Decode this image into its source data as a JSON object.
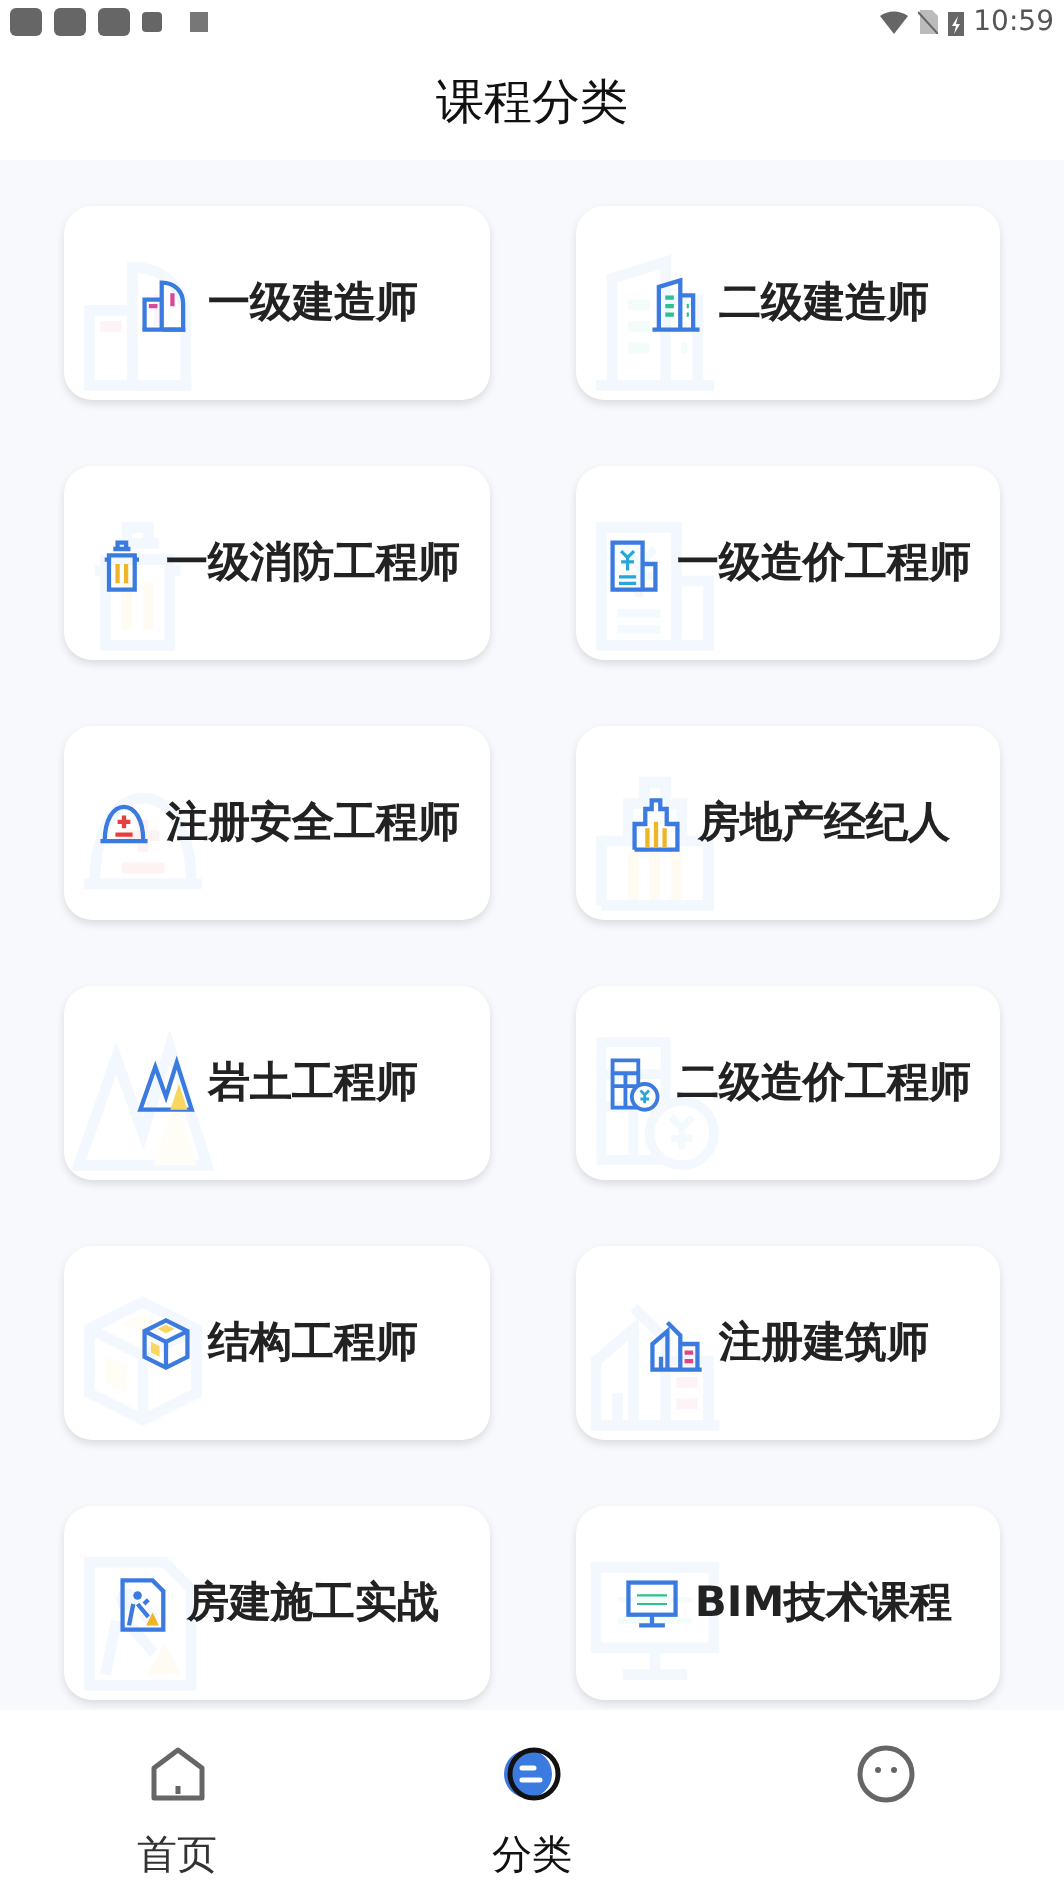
{
  "status_bar": {
    "time": "10:59"
  },
  "header": {
    "title": "课程分类"
  },
  "categories": [
    {
      "label": "一级建造师"
    },
    {
      "label": "二级建造师"
    },
    {
      "label": "一级消防工程师"
    },
    {
      "label": "一级造价工程师"
    },
    {
      "label": "注册安全工程师"
    },
    {
      "label": "房地产经纪人"
    },
    {
      "label": "岩土工程师"
    },
    {
      "label": "二级造价工程师"
    },
    {
      "label": "结构工程师"
    },
    {
      "label": "注册建筑师"
    },
    {
      "label": "房建施工实战"
    },
    {
      "label": "BIM技术课程"
    }
  ],
  "tabs": [
    {
      "label": "首页",
      "selected": false
    },
    {
      "label": "分类",
      "selected": true
    },
    {
      "selected": false
    }
  ]
}
